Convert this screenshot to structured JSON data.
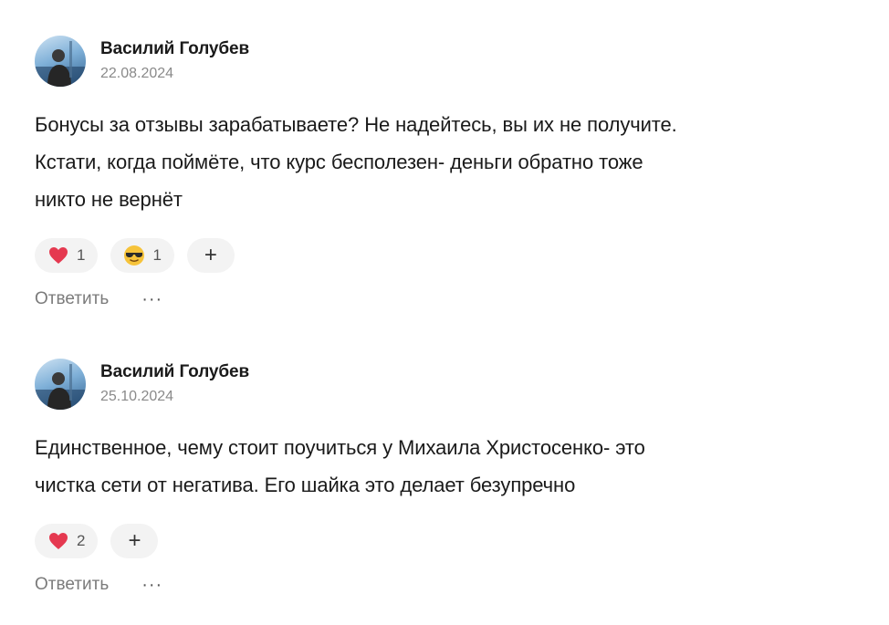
{
  "comments": [
    {
      "author": "Василий Голубев",
      "date": "22.08.2024",
      "text_lines": [
        "Бонусы за отзывы зарабатываете? Не надейтесь, вы их не получите.",
        "Кстати, когда поймёте, что курс бесполезен- деньги обратно тоже",
        "никто не вернёт"
      ],
      "reactions": [
        {
          "icon": "heart-icon",
          "count": "1"
        },
        {
          "icon": "sunglasses-emoji-icon",
          "count": "1"
        }
      ],
      "add_reaction": "+",
      "reply_label": "Ответить",
      "more_label": "···"
    },
    {
      "author": "Василий Голубев",
      "date": "25.10.2024",
      "text_lines": [
        "Единственное, чему стоит поучиться у Михаила Христосенко- это",
        "чистка сети от негатива. Его шайка это делает безупречно"
      ],
      "reactions": [
        {
          "icon": "heart-icon",
          "count": "2"
        }
      ],
      "add_reaction": "+",
      "reply_label": "Ответить",
      "more_label": "···"
    }
  ],
  "colors": {
    "heart": "#e53950",
    "pill_bg": "#f3f3f3",
    "muted_text": "#7b7b7b",
    "date_text": "#8a8a8a"
  }
}
